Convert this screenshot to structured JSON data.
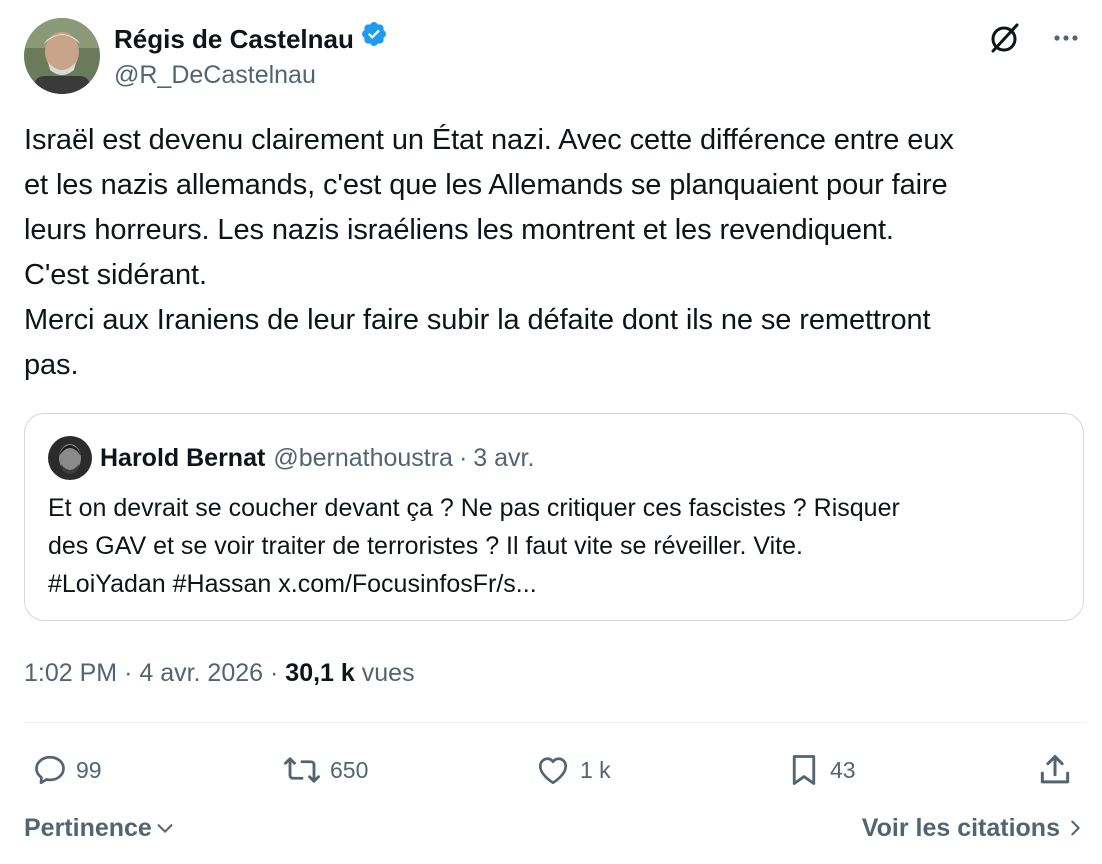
{
  "tweet": {
    "author": {
      "name": "Régis de Castelnau",
      "handle": "@R_DeCastelnau",
      "verified": true
    },
    "text": "Israël est devenu clairement un État nazi. Avec cette différence entre eux\net les nazis allemands, c'est que les Allemands se planquaient pour faire\nleurs horreurs. Les nazis israéliens les montrent et les revendiquent.\nC'est sidérant.\nMerci aux Iraniens de leur faire subir la défaite dont ils ne se remettront\npas.",
    "quote": {
      "name": "Harold Bernat",
      "handle": "@bernathoustra",
      "separator": "·",
      "date": "3 avr.",
      "text": "Et on devrait se coucher devant ça ? Ne pas critiquer ces fascistes ? Risquer\ndes GAV et se voir traiter de terroristes ? Il faut vite se réveiller. Vite.\n#LoiYadan #Hassan x.com/FocusinfosFr/s..."
    },
    "time": "1:02 PM",
    "dot": "·",
    "date": "4 avr. 2026",
    "views_count": "30,1 k",
    "views_label": "vues",
    "stats": {
      "replies": "99",
      "reposts": "650",
      "likes": "1 k",
      "bookmarks": "43"
    }
  },
  "footer": {
    "sort_label": "Pertinence",
    "quotes_link": "Voir les citations"
  },
  "colors": {
    "text": "#0f1419",
    "secondary": "#536471",
    "verified": "#1d9bf0",
    "border": "#cfd9de"
  },
  "icons": {
    "verified": "verified-badge-icon",
    "grok": "grok-icon",
    "more": "more-icon",
    "reply": "reply-icon",
    "repost": "repost-icon",
    "like": "heart-icon",
    "bookmark": "bookmark-icon",
    "share": "share-icon",
    "chevron_down": "chevron-down-icon",
    "chevron_right": "chevron-right-icon"
  }
}
